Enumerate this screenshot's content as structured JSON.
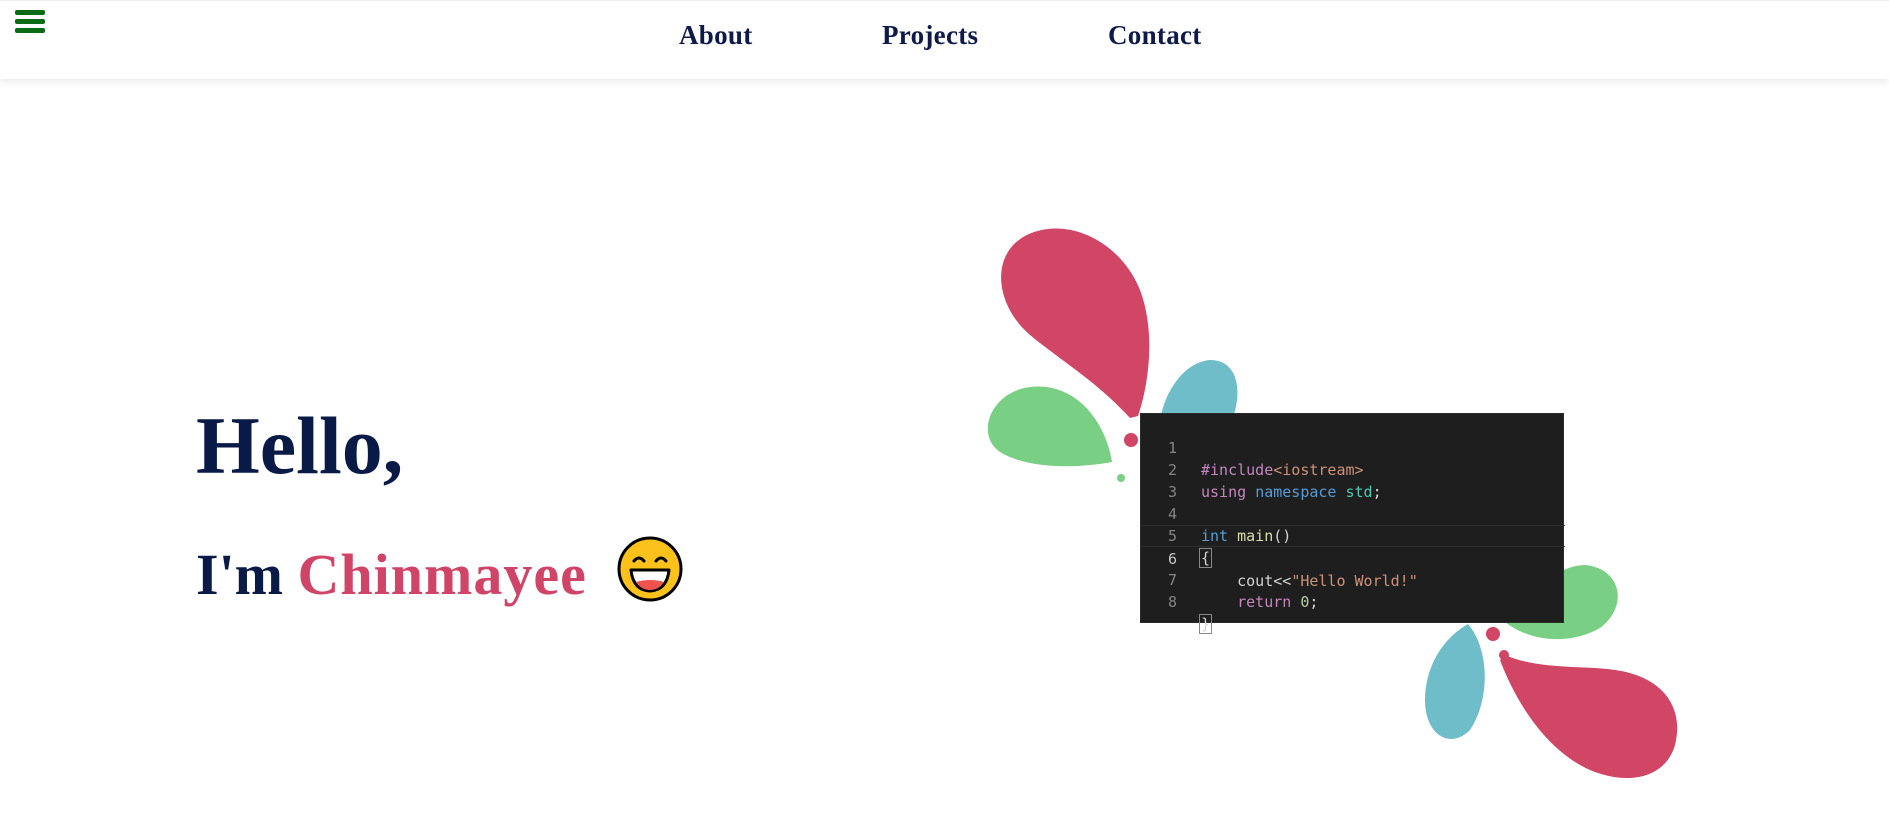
{
  "nav": {
    "items": [
      {
        "label": "About"
      },
      {
        "label": "Projects"
      },
      {
        "label": "Contact"
      }
    ],
    "menu_icon": "hamburger-menu-icon"
  },
  "hero": {
    "greeting": "Hello,",
    "intro_prefix": "I'm ",
    "name": "Chinmayee",
    "emoji": "😄"
  },
  "code_window": {
    "lines": [
      {
        "number": "1",
        "text": "#include<iostream>"
      },
      {
        "number": "2",
        "text": "using namespace std;"
      },
      {
        "number": "3",
        "text": ""
      },
      {
        "number": "4",
        "text": "int main()"
      },
      {
        "number": "5",
        "text": "{"
      },
      {
        "number": "6",
        "text": "    cout<<\"Hello World!\""
      },
      {
        "number": "7",
        "text": "    return 0;"
      },
      {
        "number": "8",
        "text": "}"
      }
    ]
  },
  "colors": {
    "navy": "#081a45",
    "accent_pink": "#d04468",
    "menu_green": "#0b6b14",
    "splash_red": "#d14565",
    "splash_green": "#79cf83",
    "splash_blue": "#6fbdc9",
    "editor_bg": "#1e1e1e"
  }
}
